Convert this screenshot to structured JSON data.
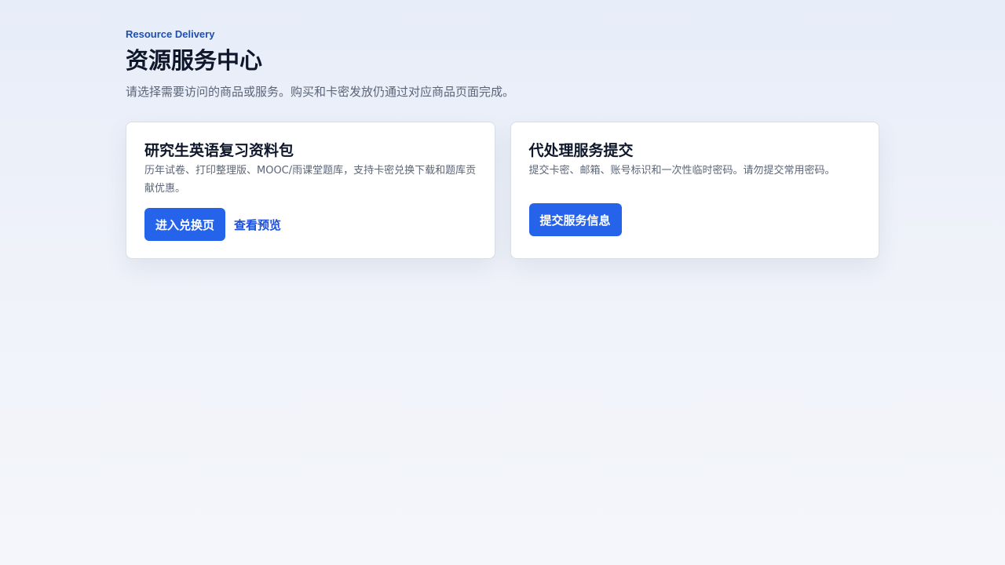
{
  "header": {
    "eyebrow": "Resource Delivery",
    "title": "资源服务中心",
    "subtitle": "请选择需要访问的商品或服务。购买和卡密发放仍通过对应商品页面完成。"
  },
  "cards": [
    {
      "title": "研究生英语复习资料包",
      "description": "历年试卷、打印整理版、MOOC/雨课堂题库，支持卡密兑换下载和题库贡献优惠。",
      "primary_label": "进入兑换页",
      "secondary_label": "查看预览"
    },
    {
      "title": "代处理服务提交",
      "description": "提交卡密、邮箱、账号标识和一次性临时密码。请勿提交常用密码。",
      "primary_label": "提交服务信息"
    }
  ],
  "colors": {
    "accent": "#2563eb",
    "eyebrow": "#1d4fb3",
    "text": "#0f172a",
    "muted": "#5b6577"
  }
}
